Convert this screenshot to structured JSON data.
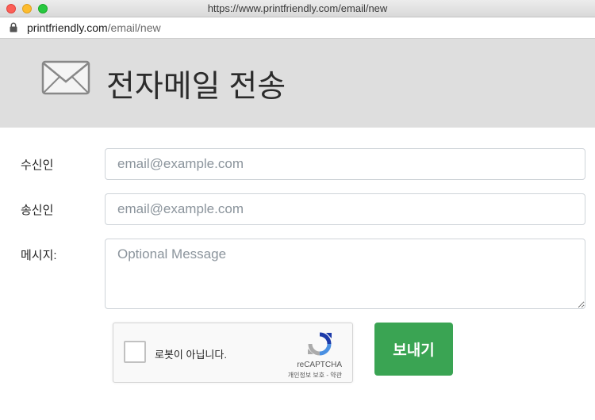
{
  "window": {
    "title": "https://www.printfriendly.com/email/new"
  },
  "address_bar": {
    "domain": "printfriendly.com",
    "path": "/email/new"
  },
  "header": {
    "title": "전자메일 전송",
    "icon": "envelope-icon"
  },
  "form": {
    "recipient": {
      "label": "수신인",
      "placeholder": "email@example.com",
      "value": ""
    },
    "sender": {
      "label": "송신인",
      "placeholder": "email@example.com",
      "value": ""
    },
    "message": {
      "label": "메시지:",
      "placeholder": "Optional Message",
      "value": ""
    }
  },
  "recaptcha": {
    "checkbox_label": "로봇이 아닙니다.",
    "brand": "reCAPTCHA",
    "privacy_link": "개인정보 보호",
    "separator": "-",
    "terms_link": "약관"
  },
  "send_button": {
    "label": "보내기"
  },
  "colors": {
    "header_bg": "#dedede",
    "send_button": "#3aa453"
  }
}
